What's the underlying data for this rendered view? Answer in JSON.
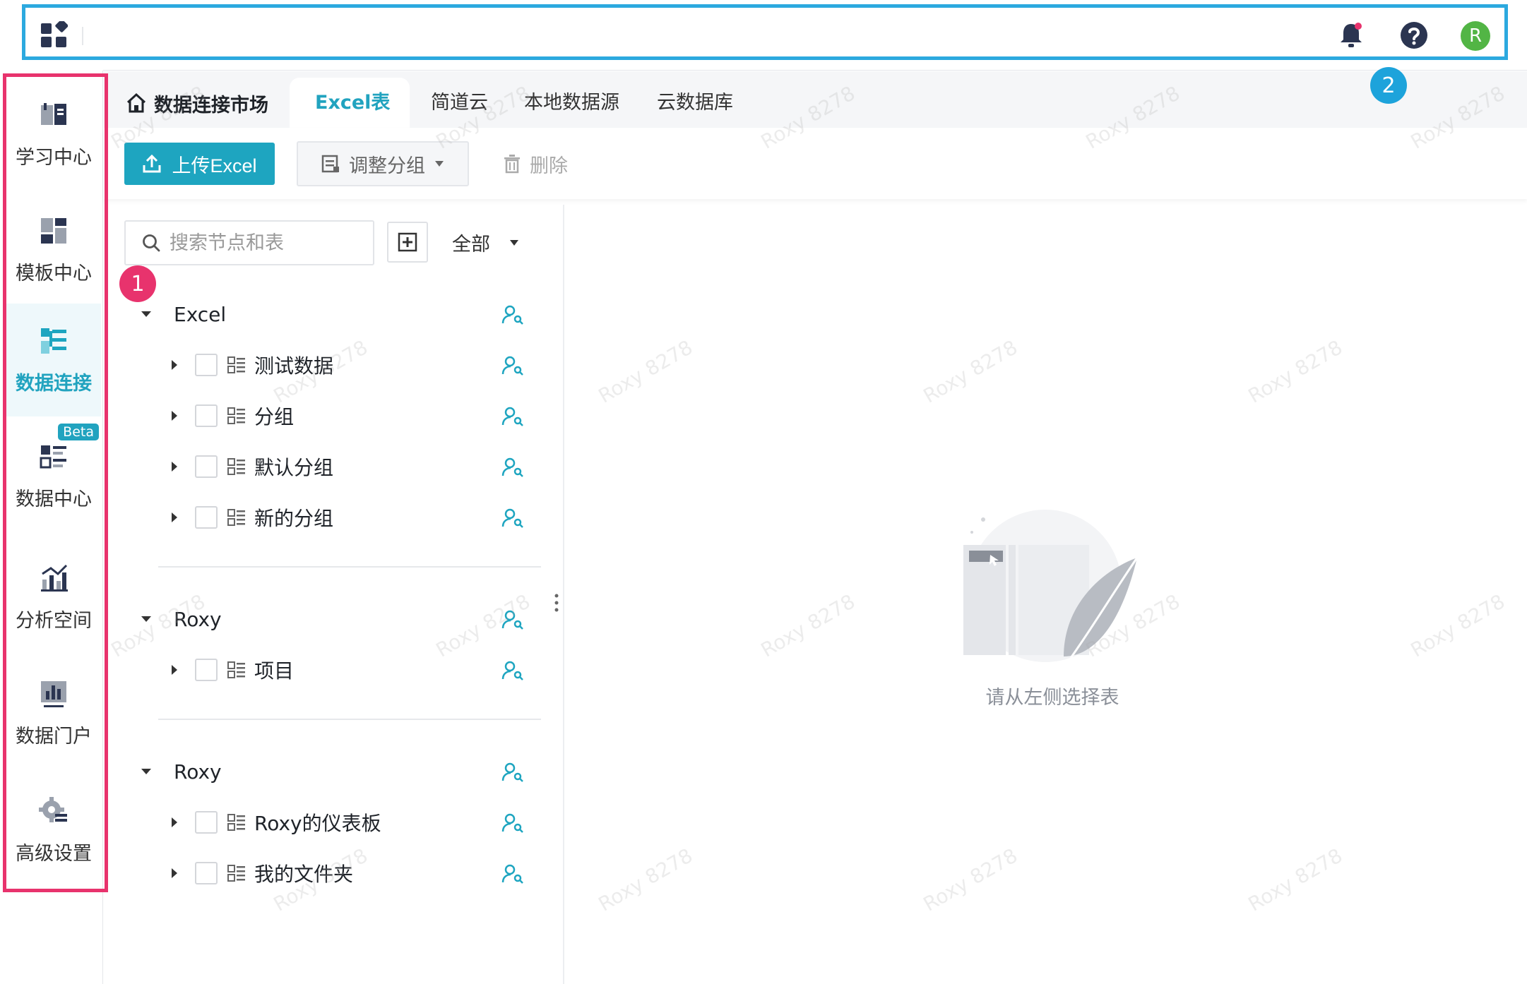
{
  "topbar": {
    "apps_icon": "apps-grid-icon",
    "bell_icon": "bell-icon",
    "help_icon": "help-circle-icon",
    "avatar_initial": "R",
    "avatar_color": "#52b545"
  },
  "sidebar": {
    "items": [
      {
        "label": "学习中心",
        "icon": "book-icon"
      },
      {
        "label": "模板中心",
        "icon": "template-icon"
      },
      {
        "label": "数据连接",
        "icon": "data-connect-icon",
        "active": true
      },
      {
        "label": "数据中心",
        "icon": "data-center-icon",
        "badge": "Beta"
      },
      {
        "label": "分析空间",
        "icon": "analysis-icon"
      },
      {
        "label": "数据门户",
        "icon": "portal-icon"
      },
      {
        "label": "高级设置",
        "icon": "gear-icon"
      }
    ]
  },
  "tabs": {
    "breadcrumb": "数据连接市场",
    "items": [
      "Excel表",
      "简道云",
      "本地数据源",
      "云数据库"
    ],
    "active": "Excel表"
  },
  "toolbar": {
    "upload_label": "上传Excel",
    "group_label": "调整分组",
    "delete_label": "删除"
  },
  "tree": {
    "search_placeholder": "搜索节点和表",
    "filter_label": "全部",
    "groups": [
      {
        "name": "Excel",
        "children": [
          "测试数据",
          "分组",
          "默认分组",
          "新的分组"
        ]
      },
      {
        "name": "Roxy",
        "children": [
          "项目"
        ]
      },
      {
        "name": "Roxy",
        "children": [
          "Roxy的仪表板",
          "我的文件夹"
        ]
      }
    ]
  },
  "empty_state": {
    "text": "请从左侧选择表"
  },
  "annotations": {
    "badge_1": "1",
    "badge_2": "2"
  },
  "watermark": "Roxy 8278",
  "colors": {
    "accent": "#1ea5c0",
    "highlight_red": "#e8336d",
    "highlight_blue": "#2ca9df"
  }
}
